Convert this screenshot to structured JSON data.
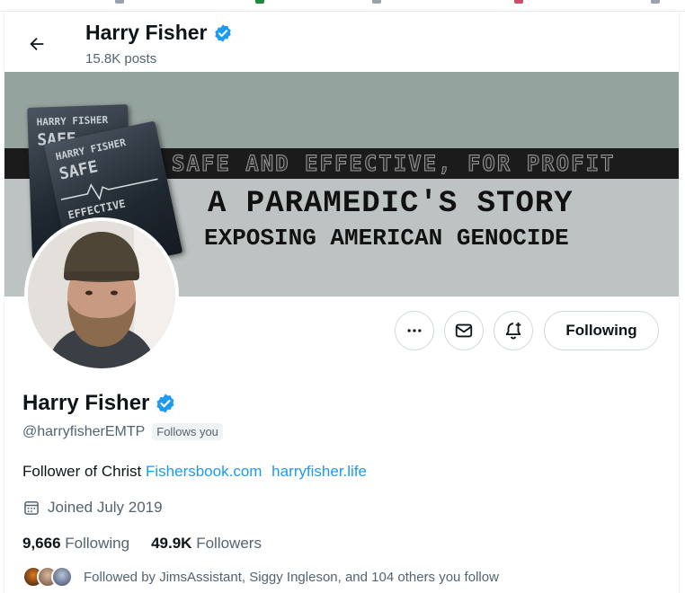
{
  "header": {
    "name": "Harry Fisher",
    "posts": "15.8K posts"
  },
  "banner": {
    "led_text": "SAFE AND EFFECTIVE, FOR PROFIT",
    "title_line1": "A PARAMEDIC'S STORY",
    "title_line2": "EXPOSING AMERICAN GENOCIDE",
    "book_author": "HARRY FISHER",
    "book_title": "SAFE",
    "book_subtitle": "EFFECTIVE"
  },
  "actions": {
    "follow_label": "Following"
  },
  "profile": {
    "name": "Harry Fisher",
    "handle": "@harryfisherEMTP",
    "follows_you": "Follows you",
    "bio_text": "Follower of Christ",
    "bio_link1": "Fishersbook.com",
    "bio_link2": "harryfisher.life",
    "joined": "Joined July 2019",
    "following_count": "9,666",
    "following_label": "Following",
    "followers_count": "49.9K",
    "followers_label": "Followers",
    "followed_by": "Followed by JimsAssistant, Siggy Ingleson, and 104 others you follow"
  },
  "colors": {
    "accent": "#1d9bf0",
    "verified": "#1d9bf0",
    "muted": "#536471"
  }
}
